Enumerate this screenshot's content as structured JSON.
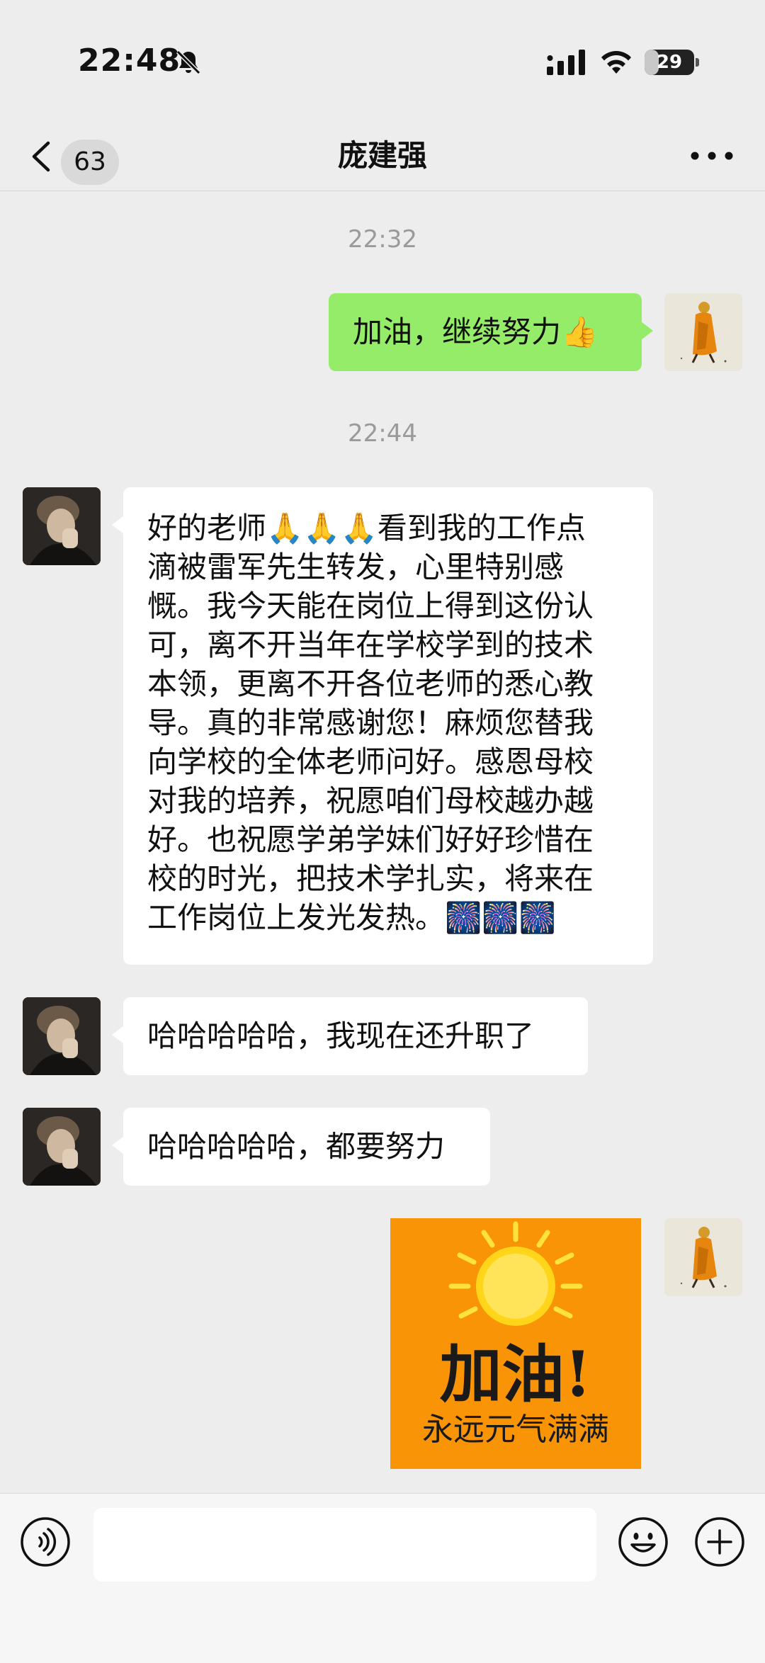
{
  "status_bar": {
    "time": "22:48",
    "battery_level": "29",
    "battery_fraction": 0.29
  },
  "nav": {
    "unread_count": "63",
    "title": "庞建强"
  },
  "messages": {
    "ts1": "22:32",
    "m1": "加油，继续努力👍",
    "ts2": "22:44",
    "m2_lines": [
      "好的老师🙏🙏🙏看到我的工作点",
      "滴被雷军先生转发，心里特别感",
      "慨。我今天能在岗位上得到这份认",
      "可，离不开当年在学校学到的技术",
      "本领，更离不开各位老师的悉心教",
      "导。真的非常感谢您！麻烦您替我",
      "向学校的全体老师问好。感恩母校",
      "对我的培养，祝愿咱们母校越办越",
      "好。也祝愿学弟学妹们好好珍惜在",
      "校的时光，把技术学扎实，将来在",
      "工作岗位上发光发热。🎆🎆🎆"
    ],
    "m3": "哈哈哈哈哈，我现在还升职了",
    "m4": "哈哈哈哈哈，都要努力",
    "sticker": {
      "main_text": "加油!",
      "sub_text": "永远元气满满"
    }
  },
  "input_bar": {
    "placeholder": ""
  },
  "icons": {
    "bell": "bell-slash-icon",
    "signal": "signal-icon",
    "wifi": "wifi-icon",
    "back": "chevron-left-icon",
    "more": "more-dots-icon",
    "voice": "voice-icon",
    "emoji": "emoji-icon",
    "plus": "plus-icon"
  },
  "colors": {
    "background": "#ededed",
    "outgoing_bubble": "#95ec69",
    "incoming_bubble": "#ffffff",
    "sticker_background": "#f99407"
  }
}
